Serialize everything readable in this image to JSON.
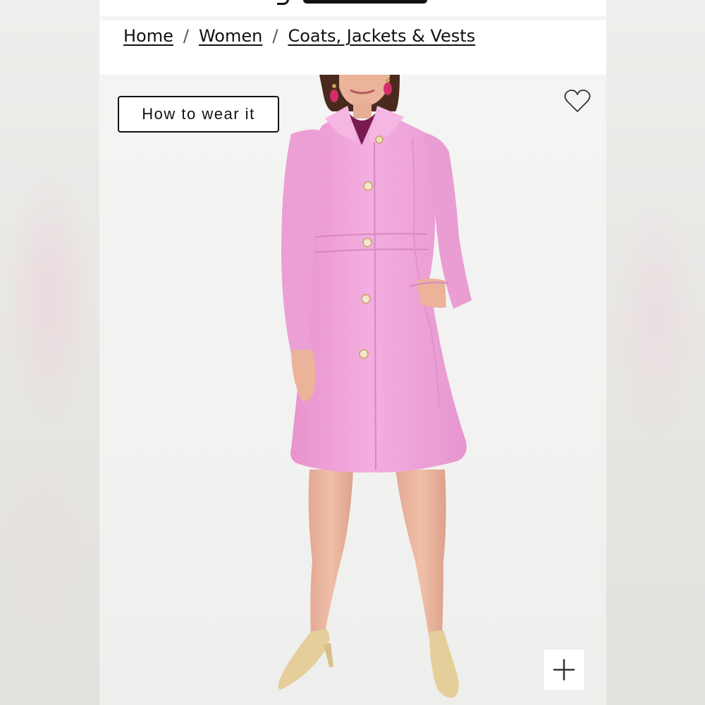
{
  "breadcrumb": {
    "items": [
      {
        "label": "Home"
      },
      {
        "label": "Women"
      },
      {
        "label": "Coats, Jackets & Vests"
      }
    ],
    "separator": "/"
  },
  "product": {
    "how_to_wear_label": "How to wear it",
    "icons": {
      "favorite": "heart-outline-icon",
      "zoom": "plus-icon"
    },
    "colors": {
      "coat": "#f1a6db",
      "accent_earring": "#d42c6a"
    }
  }
}
